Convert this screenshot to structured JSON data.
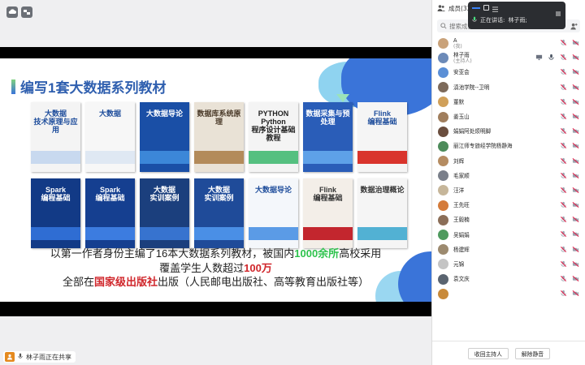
{
  "slide": {
    "title": "编写1套大数据系列教材",
    "books_row1": [
      {
        "label": "大数据\n技术原理与应用",
        "bg": "#f4f4f4",
        "fg": "#1f4e9c",
        "stripe": "#c8d9ef"
      },
      {
        "label": "大数据",
        "bg": "#f7f7f7",
        "fg": "#1f4e9c",
        "stripe": "#dfe8f3"
      },
      {
        "label": "大数据导论",
        "bg": "#1a4fa6",
        "fg": "#ffffff",
        "stripe": "#3c87d8"
      },
      {
        "label": "数据库系统原理",
        "bg": "#e9e2d6",
        "fg": "#4b3b2a",
        "stripe": "#b38b5a"
      },
      {
        "label": "PYTHON\nPython\n程序设计基础教程",
        "bg": "#f4f4f4",
        "fg": "#222222",
        "stripe": "#55c080"
      },
      {
        "label": "数据采集与预处理",
        "bg": "#2a5db8",
        "fg": "#ffffff",
        "stripe": "#5ea1e8"
      },
      {
        "label": "Flink\n编程基础",
        "bg": "#f5f5f5",
        "fg": "#1f4e9c",
        "stripe": "#d9342c"
      }
    ],
    "books_row2": [
      {
        "label": "Spark\n编程基础",
        "bg": "#123a86",
        "fg": "#ffffff",
        "stripe": "#2f6dd3"
      },
      {
        "label": "Spark\n编程基础",
        "bg": "#153f90",
        "fg": "#ffffff",
        "stripe": "#3c7ce0"
      },
      {
        "label": "大数据\n实训案例",
        "bg": "#1b3f7d",
        "fg": "#ffffff",
        "stripe": "#3773cf"
      },
      {
        "label": "大数据\n实训案例",
        "bg": "#1f4b99",
        "fg": "#ffffff",
        "stripe": "#4a8fe6"
      },
      {
        "label": "大数据导论",
        "bg": "#f4f7fb",
        "fg": "#1f4e9c",
        "stripe": "#5b9be6"
      },
      {
        "label": "Flink\n编程基础",
        "bg": "#f3eee8",
        "fg": "#333333",
        "stripe": "#c3262e"
      },
      {
        "label": "数据治理概论",
        "bg": "#f5f5f5",
        "fg": "#333333",
        "stripe": "#52b1d3"
      }
    ],
    "caption_line1_a": "以第一作者身份主编了16本大数据系列教材，被国内",
    "caption_line1_hl": "1000余所",
    "caption_line1_b": "高校采用",
    "caption_line2_a": "覆盖学生人数超过",
    "caption_line2_hl": "100万",
    "caption_line3_a": "全部在",
    "caption_line3_hl": "国家级出版社",
    "caption_line3_b": "出版（人民邮电出版社、高等教育出版社等）"
  },
  "share_status": "林子雨正在共享",
  "floating_bar": {
    "speaking_label": "正在讲话:",
    "speaker": "林子雨;"
  },
  "panel": {
    "title": "成员(32)",
    "search_placeholder": "搜索成员",
    "members": [
      {
        "name": "A",
        "sub": "(我)",
        "color": "#c9a27a"
      },
      {
        "name": "林子雨",
        "sub": "(主持人)",
        "color": "#6c8ab8"
      },
      {
        "name": "安亚会",
        "sub": "",
        "color": "#5b8fd6"
      },
      {
        "name": "滇池学院--卫明",
        "sub": "",
        "color": "#7d6a5a"
      },
      {
        "name": "董默",
        "sub": "",
        "color": "#d0a05a"
      },
      {
        "name": "姜玉山",
        "sub": "",
        "color": "#a07e5d"
      },
      {
        "name": "娟娟阿处烦明脚",
        "sub": "",
        "color": "#6a4e3e"
      },
      {
        "name": "丽江师专旅经学院杨静海",
        "sub": "",
        "color": "#4d8b5a"
      },
      {
        "name": "刘辉",
        "sub": "",
        "color": "#b58c62"
      },
      {
        "name": "毛家顺",
        "sub": "",
        "color": "#7a7f8a"
      },
      {
        "name": "汪洋",
        "sub": "",
        "color": "#c6b69a"
      },
      {
        "name": "王先旺",
        "sub": "",
        "color": "#d47b3a"
      },
      {
        "name": "王毅楠",
        "sub": "",
        "color": "#8b6e58"
      },
      {
        "name": "吴娟娟",
        "sub": "",
        "color": "#4f9a5e"
      },
      {
        "name": "杨建辉",
        "sub": "",
        "color": "#9c8a6f"
      },
      {
        "name": "元锦",
        "sub": "",
        "color": "#c4c4c4"
      },
      {
        "name": "袁文庆",
        "sub": "",
        "color": "#5a6470"
      },
      {
        "name": "",
        "sub": "",
        "color": "#c88a3a"
      }
    ],
    "footer_btn1": "收回主持人",
    "footer_btn2": "解除静音"
  }
}
